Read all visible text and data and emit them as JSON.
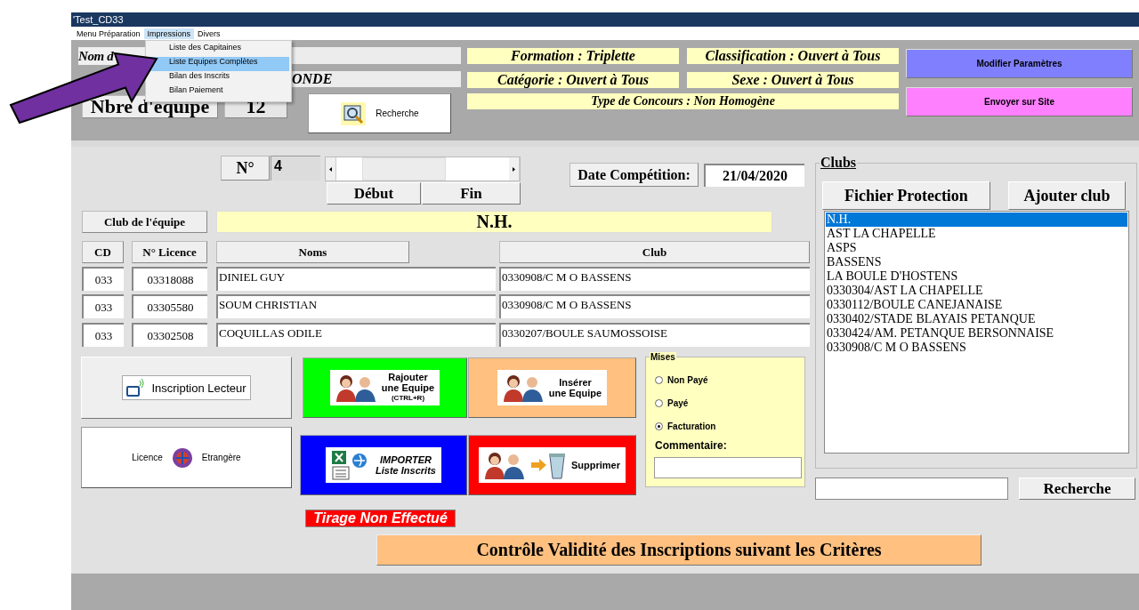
{
  "window": {
    "title": "'Test_CD33"
  },
  "menu_bar": [
    {
      "label": "Menu Préparation",
      "selected": false
    },
    {
      "label": "Impressions",
      "selected": true
    },
    {
      "label": "Divers",
      "selected": false
    }
  ],
  "dropdown": [
    {
      "label": "Liste des Capitaines",
      "selected": false
    },
    {
      "label": "Liste Equipes Complètes",
      "selected": true
    },
    {
      "label": "Bilan des Inscrits",
      "selected": false
    },
    {
      "label": "Bilan Paiement",
      "selected": false
    }
  ],
  "header": {
    "name_label": "Nom d",
    "name_value": "ONDE",
    "team_count_label": "Nbre d'equipe",
    "team_count": "12",
    "search_button": "Recherche",
    "info": [
      "Formation : Triplette",
      "Classification : Ouvert à Tous",
      "Catégorie : Ouvert à Tous",
      "Sexe : Ouvert à Tous",
      "Type de Concours : Non Homogène"
    ],
    "buttons": [
      {
        "label": "Modifier Paramètres",
        "color": "#8080ff"
      },
      {
        "label": "Envoyer sur Site",
        "color": "#ff80ff"
      }
    ]
  },
  "navigation": {
    "number_label": "N°",
    "number": "4",
    "buttons": [
      "Début",
      "Fin"
    ]
  },
  "date": {
    "label": "Date Compétition:",
    "value": "21/04/2020"
  },
  "team_club": {
    "label": "Club de l'équipe",
    "value": "N.H."
  },
  "players": {
    "columns": [
      "CD",
      "N° Licence",
      "Noms",
      "Club"
    ],
    "rows": [
      [
        "033",
        "03318088",
        "DINIEL GUY",
        "0330908/C M O BASSENS"
      ],
      [
        "033",
        "03305580",
        "SOUM CHRISTIAN",
        "0330908/C M O BASSENS"
      ],
      [
        "033",
        "03302508",
        "COQUILLAS ODILE",
        "0330207/BOULE SAUMOSSOISE"
      ]
    ]
  },
  "side_buttons": [
    "Inscription Lecteur",
    [
      "Licence",
      "Etrangère"
    ]
  ],
  "tiles": [
    {
      "kind": "add",
      "lines": [
        "Rajouter",
        "une Equipe",
        "(CTRL+R)"
      ],
      "color": "#00ff00"
    },
    {
      "kind": "insert",
      "lines": [
        "Insérer",
        "une Equipe"
      ],
      "color": "#ffc080"
    },
    {
      "kind": "import",
      "lines": [
        "IMPORTER",
        "Liste Inscrits"
      ],
      "color": "#0000ff"
    },
    {
      "kind": "delete",
      "lines": [
        "Supprimer"
      ],
      "color": "#ff0000"
    }
  ],
  "mises": {
    "title": "Mises",
    "options": [
      {
        "label": "Non Payé",
        "selected": false
      },
      {
        "label": "Payé",
        "selected": false
      },
      {
        "label": "Facturation",
        "selected": true
      }
    ],
    "comment_label": "Commentaire:"
  },
  "clubs": {
    "title": "Clubs",
    "buttons": [
      "Fichier Protection",
      "Ajouter club"
    ],
    "items": [
      {
        "label": "N.H.",
        "selected": true
      },
      {
        "label": "AST LA CHAPELLE",
        "selected": false
      },
      {
        "label": "ASPS",
        "selected": false
      },
      {
        "label": "BASSENS",
        "selected": false
      },
      {
        "label": "LA BOULE D'HOSTENS",
        "selected": false
      },
      {
        "label": "0330304/AST LA CHAPELLE",
        "selected": false
      },
      {
        "label": "0330112/BOULE CANEJANAISE",
        "selected": false
      },
      {
        "label": "0330402/STADE BLAYAIS PETANQUE",
        "selected": false
      },
      {
        "label": "0330424/AM. PETANQUE BERSONNAISE",
        "selected": false
      },
      {
        "label": "0330908/C M O BASSENS",
        "selected": false
      }
    ],
    "search_button": "Recherche"
  },
  "draw_status": "Tirage Non Effectué",
  "validate_button": "Contrôle Validité des Inscriptions suivant les Critères"
}
